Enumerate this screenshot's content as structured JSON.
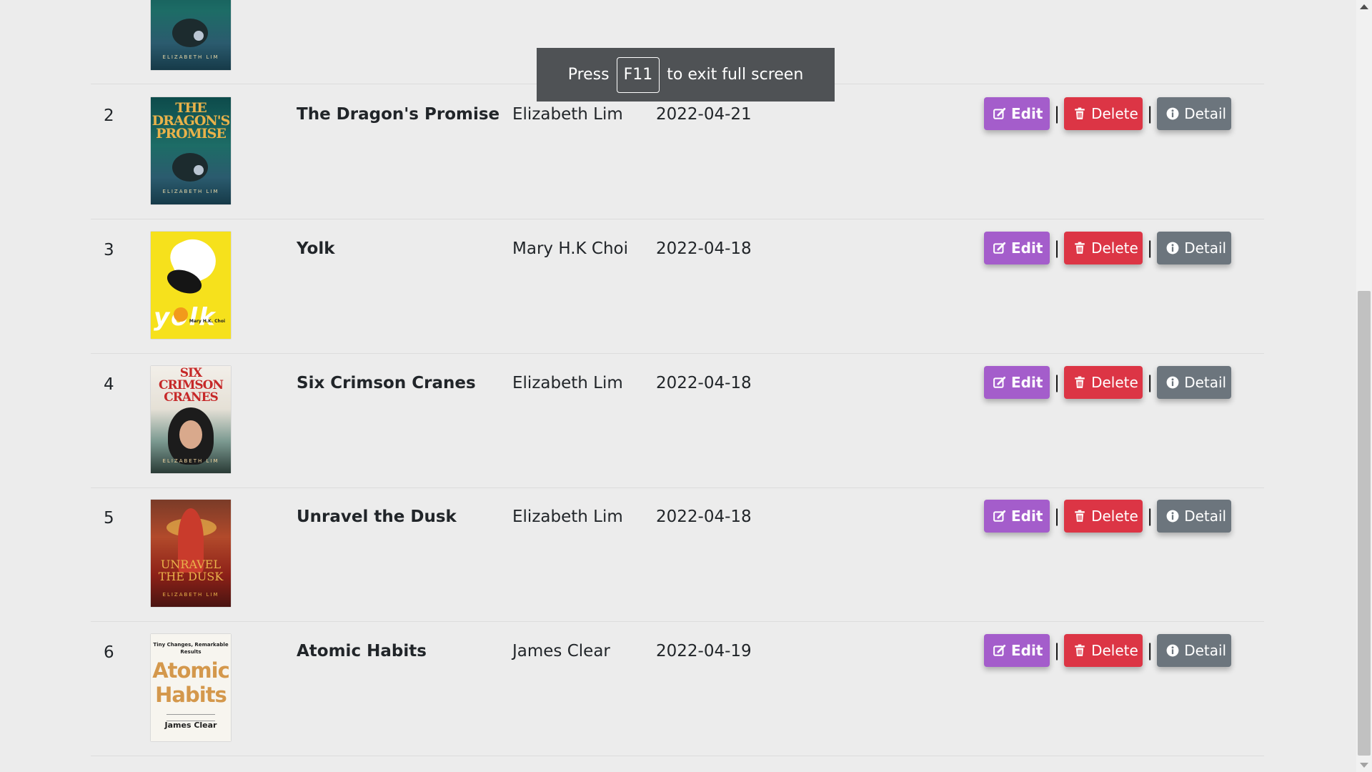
{
  "fullscreen_toast": {
    "before": "Press",
    "key": "F11",
    "after": "to exit full screen"
  },
  "buttons": {
    "edit": "Edit",
    "delete": "Delete",
    "detail": "Detail",
    "separator": "|"
  },
  "rows": [
    {
      "no": "2",
      "title": "The Dragon's Promise",
      "author": "Elizabeth Lim",
      "date": "2022-04-21",
      "cover": {
        "title_text": "THE DRAGON'S PROMISE",
        "author_text": "ELIZABETH LIM"
      }
    },
    {
      "no": "3",
      "title": "Yolk",
      "author": "Mary H.K Choi",
      "date": "2022-04-18",
      "cover": {
        "title_text": "yolk",
        "author_text": "Mary H.K. Choi"
      }
    },
    {
      "no": "4",
      "title": "Six Crimson Cranes",
      "author": "Elizabeth Lim",
      "date": "2022-04-18",
      "cover": {
        "title_text": "SIX CRIMSON CRANES",
        "author_text": "ELIZABETH LIM"
      }
    },
    {
      "no": "5",
      "title": "Unravel the Dusk",
      "author": "Elizabeth Lim",
      "date": "2022-04-18",
      "cover": {
        "title_text": "UNRAVEL THE DUSK",
        "author_text": "ELIZABETH LIM"
      }
    },
    {
      "no": "6",
      "title": "Atomic Habits",
      "author": "James Clear",
      "date": "2022-04-19",
      "cover": {
        "subtitle_text": "Tiny Changes, Remarkable Results",
        "title_text": "Atomic Habits",
        "author_text": "James Clear"
      }
    }
  ],
  "colors": {
    "edit": "#a45dcb",
    "delete": "#dc3545",
    "detail": "#6c757d",
    "background": "#ececec"
  },
  "icons": {
    "edit": "edit-icon",
    "delete": "trash-icon",
    "detail": "info-icon"
  }
}
